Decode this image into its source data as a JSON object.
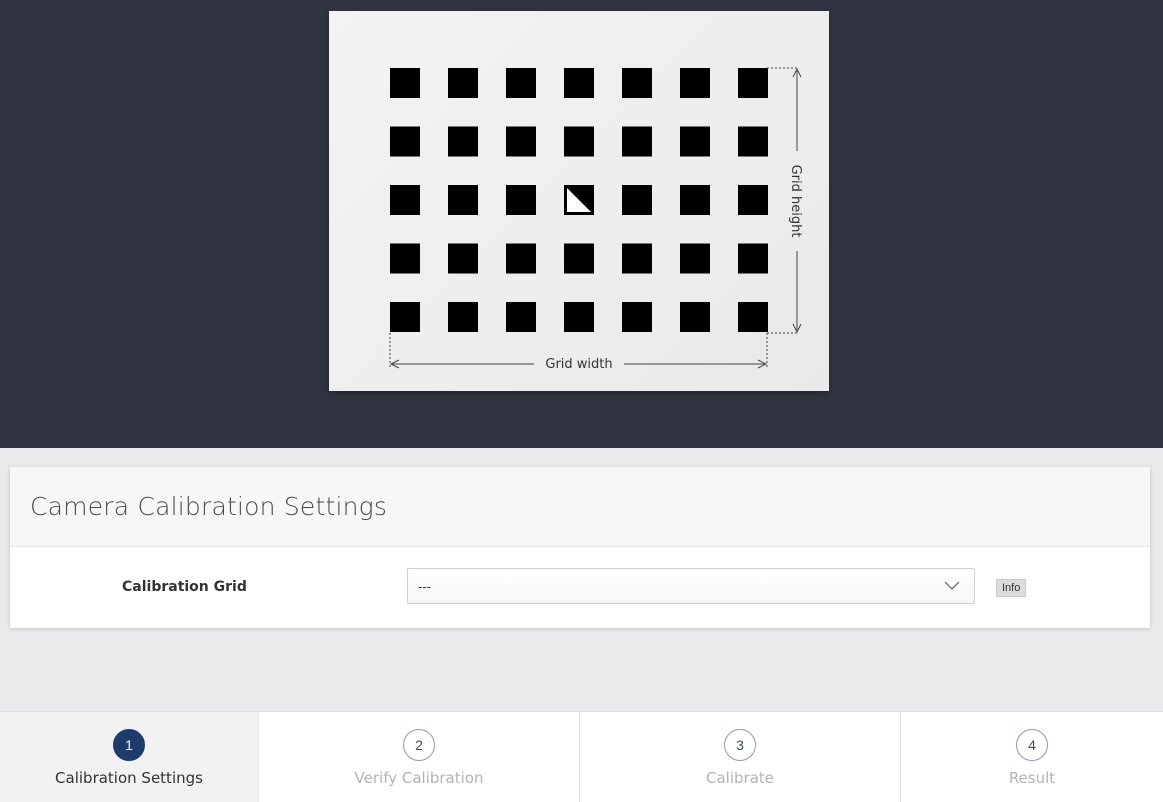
{
  "preview": {
    "grid_card": {
      "rows": 5,
      "columns": 7,
      "marker_cell": {
        "row": 3,
        "column": 4
      },
      "width_label": "Grid width",
      "height_label": "Grid height"
    }
  },
  "panel": {
    "title": "Camera Calibration Settings",
    "calibration_grid": {
      "label": "Calibration Grid",
      "selected_value": "---",
      "info_label": "Info"
    }
  },
  "steps": [
    {
      "number": "1",
      "label": "Calibration Settings",
      "active": true
    },
    {
      "number": "2",
      "label": "Verify Calibration",
      "active": false
    },
    {
      "number": "3",
      "label": "Calibrate",
      "active": false
    },
    {
      "number": "4",
      "label": "Result",
      "active": false
    }
  ],
  "colors": {
    "preview_background": "#313441",
    "active_step": "#1d3c6c",
    "inactive_text": "#b3b3b3"
  }
}
